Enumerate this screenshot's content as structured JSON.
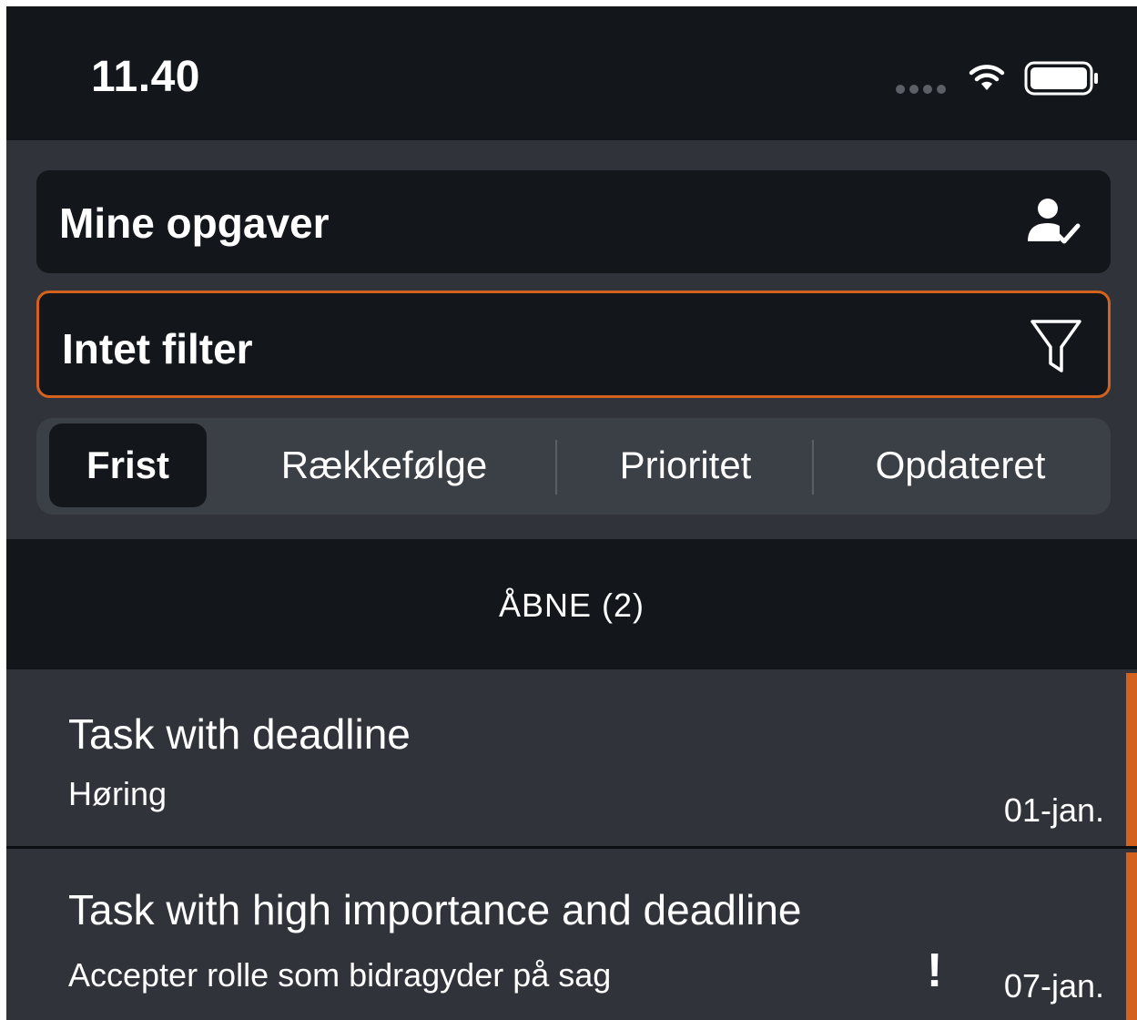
{
  "status_bar": {
    "time": "11.40",
    "icons": [
      "signal-dots-icon",
      "wifi-icon",
      "battery-icon"
    ]
  },
  "header": {
    "assignee_field": {
      "label": "Mine opgaver",
      "icon": "user-check-icon"
    },
    "filter_field": {
      "label": "Intet filter",
      "icon": "filter-icon",
      "border_color": "#d3621f"
    },
    "sort_segments": [
      {
        "label": "Frist",
        "active": true
      },
      {
        "label": "Rækkefølge",
        "active": false
      },
      {
        "label": "Prioritet",
        "active": false
      },
      {
        "label": "Opdateret",
        "active": false
      }
    ]
  },
  "section": {
    "title": "ÅBNE (2)"
  },
  "tasks": [
    {
      "title": "Task with deadline",
      "subtitle": "Høring",
      "date": "01-jan.",
      "important": false
    },
    {
      "title": "Task with high importance and deadline",
      "subtitle": "Accepter rolle som bidragyder på sag",
      "date": "07-jan.",
      "important": true,
      "importance_mark": "!"
    }
  ],
  "colors": {
    "accent": "#d3621f",
    "dark_bg": "#13171c",
    "panel_bg": "#30333a",
    "segment_bg": "#3b3f46"
  }
}
